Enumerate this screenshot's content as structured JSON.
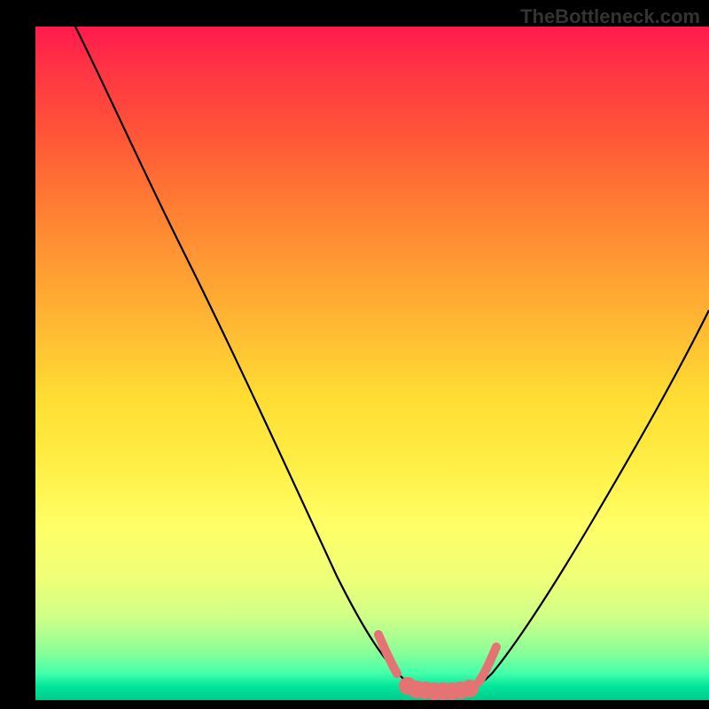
{
  "watermark": "TheBottleneck.com",
  "chart_data": {
    "type": "line",
    "title": "",
    "xlabel": "",
    "ylabel": "",
    "xlim": [
      0,
      100
    ],
    "ylim": [
      0,
      100
    ],
    "background_gradient": {
      "top": "#ff1a4d",
      "middle": "#ffee33",
      "bottom": "#00cc8c"
    },
    "series": [
      {
        "name": "bottleneck-curve",
        "color": "#000000",
        "x": [
          6,
          10,
          15,
          20,
          25,
          30,
          35,
          40,
          45,
          50,
          52,
          54,
          56,
          58,
          60,
          62,
          64,
          66,
          70,
          75,
          80,
          85,
          90,
          95,
          100
        ],
        "values": [
          100,
          92,
          83,
          73,
          63,
          54,
          44,
          35,
          25,
          14,
          10,
          6,
          3,
          2,
          2,
          2,
          2,
          3,
          6,
          12,
          20,
          29,
          38,
          48,
          58
        ]
      }
    ],
    "highlight": {
      "name": "optimal-zone",
      "color": "#e67373",
      "x": [
        51,
        53,
        55,
        56,
        57,
        58,
        59,
        60,
        61,
        62,
        63,
        64,
        65,
        67
      ],
      "values": [
        11,
        7,
        4,
        3,
        3,
        2,
        2,
        2,
        2,
        2,
        2,
        2,
        3,
        5
      ]
    }
  }
}
